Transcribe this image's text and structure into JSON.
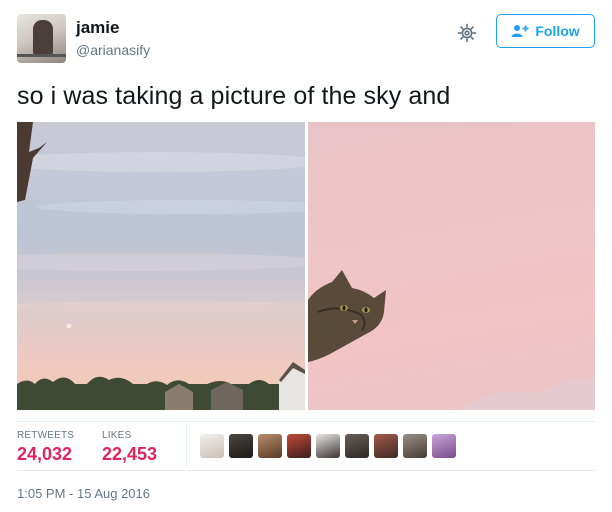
{
  "user": {
    "name": "jamie",
    "handle": "@arianasify"
  },
  "follow_button": {
    "label": "Follow",
    "icon": "add-user-icon"
  },
  "settings_icon": "gear-icon",
  "tweet": {
    "text": "so i was taking a picture of the sky and"
  },
  "media": {
    "images": [
      "sky-photo",
      "cat-photo"
    ]
  },
  "stats": {
    "retweets_label": "RETWEETS",
    "retweets_count": "24,032",
    "likes_label": "LIKES",
    "likes_count": "22,453"
  },
  "likers": [
    "liker-avatar",
    "liker-avatar",
    "liker-avatar",
    "liker-avatar",
    "liker-avatar",
    "liker-avatar",
    "liker-avatar",
    "liker-avatar",
    "liker-avatar"
  ],
  "timestamp": "1:05 PM - 15 Aug 2016",
  "colors": {
    "accent": "#1da1f2",
    "stat_count": "#e0245e",
    "secondary_text": "#657786"
  }
}
